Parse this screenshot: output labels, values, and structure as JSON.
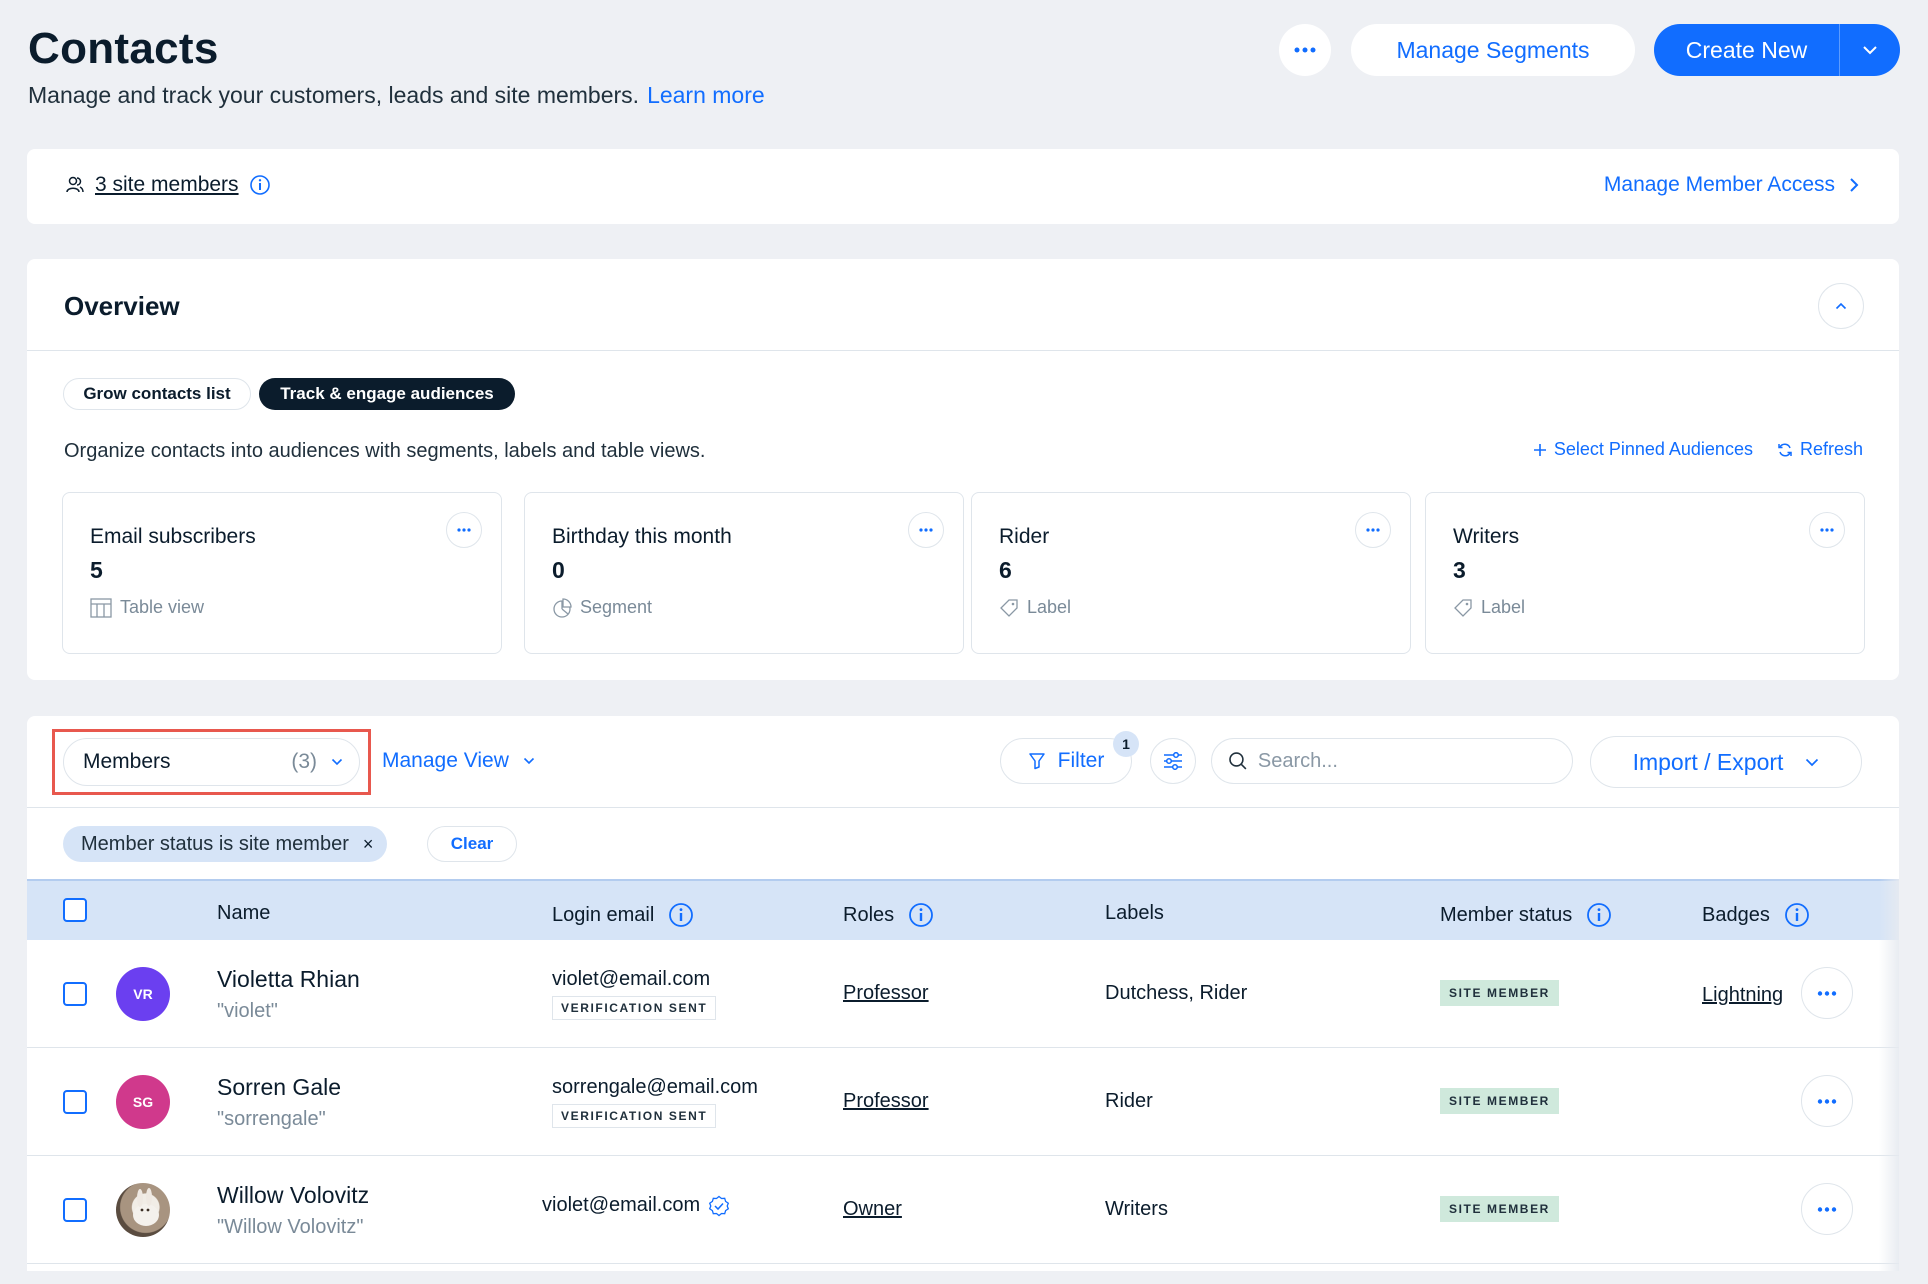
{
  "header": {
    "title": "Contacts",
    "subtitle": "Manage and track your customers, leads and site members.",
    "learn_more": "Learn more",
    "manage_segments": "Manage Segments",
    "create_new": "Create New"
  },
  "members_bar": {
    "site_members_link": "3 site members",
    "manage_access": "Manage Member Access"
  },
  "overview": {
    "title": "Overview",
    "tabs": [
      {
        "label": "Grow contacts list",
        "active": false
      },
      {
        "label": "Track & engage audiences",
        "active": true
      }
    ],
    "description": "Organize contacts into audiences with segments, labels and table views.",
    "select_pinned": "Select Pinned Audiences",
    "refresh": "Refresh",
    "audiences": [
      {
        "name": "Email subscribers",
        "count": "5",
        "kind": "Table view",
        "icon": "table-icon"
      },
      {
        "name": "Birthday this month",
        "count": "0",
        "kind": "Segment",
        "icon": "segment-icon"
      },
      {
        "name": "Rider",
        "count": "6",
        "kind": "Label",
        "icon": "label-tag-icon"
      },
      {
        "name": "Writers",
        "count": "3",
        "kind": "Label",
        "icon": "label-tag-icon"
      }
    ]
  },
  "toolbar": {
    "view_name": "Members",
    "view_count": "(3)",
    "manage_view": "Manage View",
    "filter": "Filter",
    "filter_count": "1",
    "search_placeholder": "Search...",
    "import_export": "Import / Export"
  },
  "active_filter": {
    "chip": "Member status is site member",
    "chip_remove": "×",
    "clear": "Clear"
  },
  "table": {
    "columns": {
      "name": "Name",
      "login_email": "Login email",
      "roles": "Roles",
      "labels": "Labels",
      "member_status": "Member status",
      "badges": "Badges"
    },
    "rows": [
      {
        "initials": "VR",
        "avatar_color": "#6b3ff0",
        "name": "Violetta Rhian",
        "nickname": "\"violet\"",
        "email": "violet@email.com",
        "verification": "VERIFICATION SENT",
        "role": "Professor",
        "labels": "Dutchess, Rider",
        "status": "SITE MEMBER",
        "badge": "Lightning"
      },
      {
        "initials": "SG",
        "avatar_color": "#d0398c",
        "name": "Sorren Gale",
        "nickname": "\"sorrengale\"",
        "email": "sorrengale@email.com",
        "verification": "VERIFICATION SENT",
        "role": "Professor",
        "labels": "Rider",
        "status": "SITE MEMBER",
        "badge": ""
      },
      {
        "initials": "",
        "avatar_color": "#8a7b6e",
        "name": "Willow Volovitz",
        "nickname": "\"Willow Volovitz\"",
        "email": "violet@email.com",
        "verification": "",
        "role": "Owner",
        "labels": "Writers",
        "status": "SITE MEMBER",
        "badge": ""
      }
    ]
  },
  "colors": {
    "accent": "#116dff",
    "header_row": "#d6e4f7",
    "status_badge": "#cfe9dc",
    "highlight": "#e8584e"
  }
}
